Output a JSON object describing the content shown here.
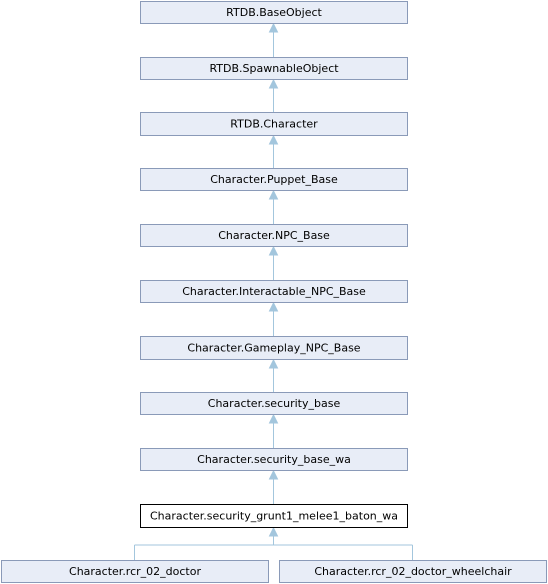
{
  "diagram": {
    "nodes": [
      {
        "id": "base_object",
        "label": "RTDB.BaseObject"
      },
      {
        "id": "spawnable_object",
        "label": "RTDB.SpawnableObject"
      },
      {
        "id": "character",
        "label": "RTDB.Character"
      },
      {
        "id": "puppet_base",
        "label": "Character.Puppet_Base"
      },
      {
        "id": "npc_base",
        "label": "Character.NPC_Base"
      },
      {
        "id": "interactable_npc_base",
        "label": "Character.Interactable_NPC_Base"
      },
      {
        "id": "gameplay_npc_base",
        "label": "Character.Gameplay_NPC_Base"
      },
      {
        "id": "security_base",
        "label": "Character.security_base"
      },
      {
        "id": "security_base_wa",
        "label": "Character.security_base_wa"
      },
      {
        "id": "security_grunt1_melee1_baton_wa",
        "label": "Character.security_grunt1_melee1_baton_wa",
        "current": true
      },
      {
        "id": "rcr_02_doctor",
        "label": "Character.rcr_02_doctor"
      },
      {
        "id": "rcr_02_doctor_wheelchair",
        "label": "Character.rcr_02_doctor_wheelchair"
      }
    ],
    "edges": [
      {
        "from": "spawnable_object",
        "to": "base_object"
      },
      {
        "from": "character",
        "to": "spawnable_object"
      },
      {
        "from": "puppet_base",
        "to": "character"
      },
      {
        "from": "npc_base",
        "to": "puppet_base"
      },
      {
        "from": "interactable_npc_base",
        "to": "npc_base"
      },
      {
        "from": "gameplay_npc_base",
        "to": "interactable_npc_base"
      },
      {
        "from": "security_base",
        "to": "gameplay_npc_base"
      },
      {
        "from": "security_base_wa",
        "to": "security_base"
      },
      {
        "from": "security_grunt1_melee1_baton_wa",
        "to": "security_base_wa"
      },
      {
        "from": "rcr_02_doctor",
        "to": "security_grunt1_melee1_baton_wa"
      },
      {
        "from": "rcr_02_doctor_wheelchair",
        "to": "security_grunt1_melee1_baton_wa"
      }
    ],
    "colors": {
      "node_fill": "#e8edf7",
      "node_border": "#8a9ab8",
      "current_fill": "#ffffff",
      "current_border": "#000000",
      "edge": "#a3c6dd"
    }
  }
}
